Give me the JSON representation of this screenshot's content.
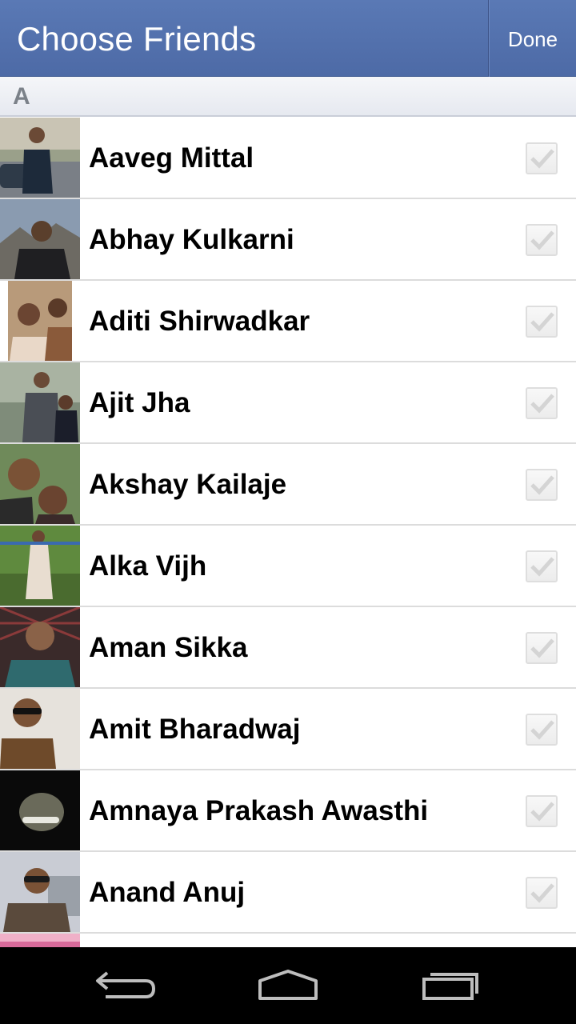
{
  "header": {
    "title": "Choose Friends",
    "done_label": "Done"
  },
  "section": {
    "letter": "A"
  },
  "friends": [
    {
      "name": "Aaveg Mittal",
      "checked": false
    },
    {
      "name": "Abhay Kulkarni",
      "checked": false
    },
    {
      "name": "Aditi Shirwadkar",
      "checked": false
    },
    {
      "name": "Ajit Jha",
      "checked": false
    },
    {
      "name": "Akshay Kailaje",
      "checked": false
    },
    {
      "name": "Alka Vijh",
      "checked": false
    },
    {
      "name": "Aman Sikka",
      "checked": false
    },
    {
      "name": "Amit Bharadwaj",
      "checked": false
    },
    {
      "name": "Amnaya Prakash Awasthi",
      "checked": false
    },
    {
      "name": "Anand Anuj",
      "checked": false
    }
  ],
  "navbar": {
    "icons": [
      "back-icon",
      "home-icon",
      "recent-apps-icon"
    ]
  },
  "colors": {
    "titlebar": "#4d6aa6",
    "section_text": "#7b8189",
    "checkbox_mark": "#d4d4d4"
  }
}
